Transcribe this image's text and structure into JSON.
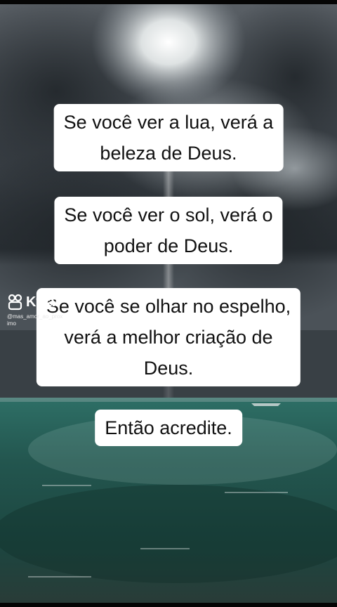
{
  "scene": {
    "description_icon": "stormy-sky-over-sea-photo",
    "colors": {
      "sky_dark": "#3a3f45",
      "sun_glow": "#f4f6f6",
      "sea": "#2f6b5f",
      "caption_bg": "#ffffff",
      "caption_text": "#111111"
    }
  },
  "captions": [
    {
      "lines": [
        "Se você ver a lua, verá a",
        "beleza de Deus."
      ]
    },
    {
      "lines": [
        "Se você ver o sol, verá o",
        "poder de Deus."
      ]
    },
    {
      "lines": [
        "Se você se olhar no espelho,",
        "verá a melhor criação de",
        "Deus."
      ]
    },
    {
      "lines": [
        "Então acredite."
      ]
    }
  ],
  "watermark": {
    "brand": "Kwai",
    "icon": "kwai-logo-icon",
    "handle_line1": "@mas_amor_ao_prox",
    "handle_line2": "imo"
  }
}
